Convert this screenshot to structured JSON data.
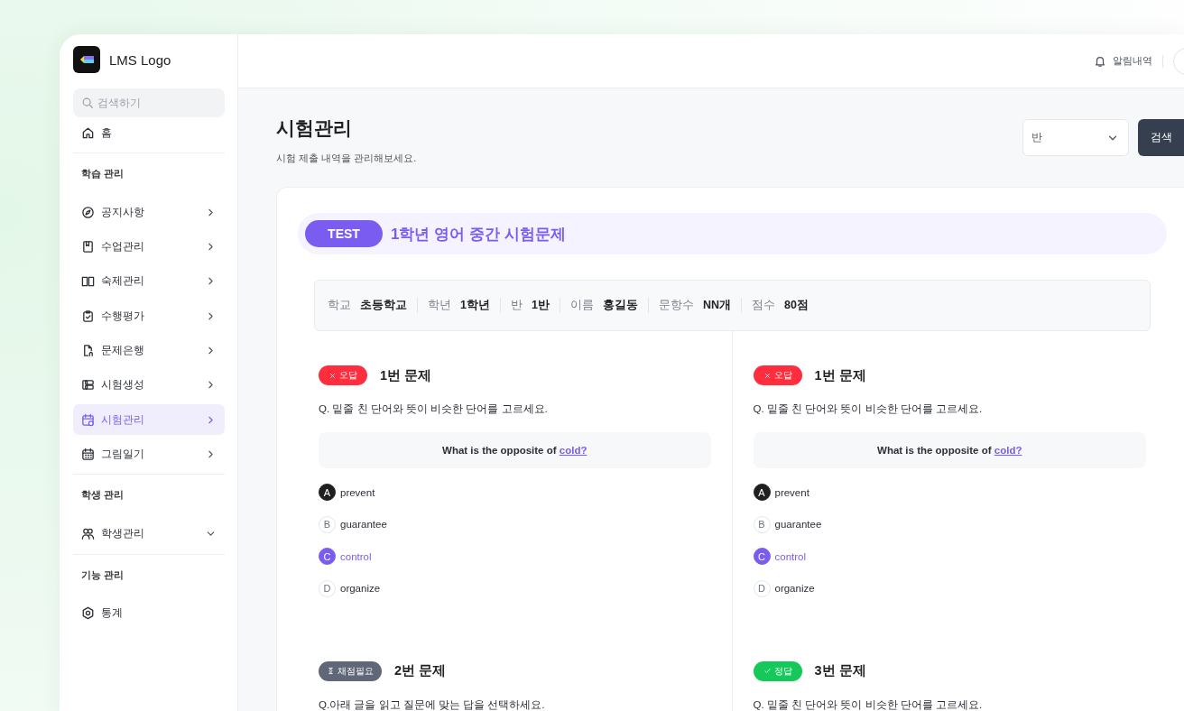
{
  "sidebar": {
    "logo": "LMS Logo",
    "search": {
      "placeholder": "검색하기"
    },
    "groups": [
      {
        "items": [
          {
            "label": "홈",
            "kind": "link",
            "selected": false
          }
        ]
      },
      {
        "title": "학습 관리",
        "items": [
          {
            "label": "공지사항",
            "kind": "submenu",
            "selected": false
          },
          {
            "label": "수업관리",
            "kind": "submenu",
            "selected": false
          },
          {
            "label": "숙제관리",
            "kind": "submenu",
            "selected": false
          },
          {
            "label": "수행평가",
            "kind": "submenu",
            "selected": false
          },
          {
            "label": "문제은행",
            "kind": "submenu",
            "selected": false
          },
          {
            "label": "시험생성",
            "kind": "submenu",
            "selected": false
          },
          {
            "label": "시험관리",
            "kind": "submenu",
            "selected": true
          },
          {
            "label": "그림일기",
            "kind": "submenu",
            "selected": false
          }
        ]
      },
      {
        "title": "학생 관리",
        "items": [
          {
            "label": "학생관리",
            "kind": "dropdown",
            "selected": false
          }
        ]
      },
      {
        "title": "기능 관리",
        "items": [
          {
            "label": "통계",
            "kind": "link",
            "selected": false
          }
        ]
      }
    ]
  },
  "header": {
    "notifications": "알림내역"
  },
  "page": {
    "title": "시험관리",
    "subtitle": "시험 제출 내역을 관리해보세요.",
    "filter": {
      "value": "반"
    },
    "search_button": "검색"
  },
  "exam": {
    "tag": "TEST",
    "title": "1학년 영어 중간 시험문제",
    "info": [
      {
        "label": "학교",
        "value": "초등학교"
      },
      {
        "label": "학년",
        "value": "1학년"
      },
      {
        "label": "반",
        "value": "1반"
      },
      {
        "label": "이름",
        "value": "홍길동"
      },
      {
        "label": "문항수",
        "value": "NN개"
      },
      {
        "label": "점수",
        "value": "80점"
      }
    ],
    "questions": [
      {
        "kind": "wrong",
        "badge": "오답",
        "title": "1번 문제",
        "instruction": "Q. 밑줄 친 단어와 뜻이 비슷한 단어를 고르세요.",
        "prompt": "What is the opposite of",
        "keyword": "cold?",
        "options": [
          {
            "letter": "A",
            "text": "prevent",
            "chosen": true,
            "correct": false
          },
          {
            "letter": "B",
            "text": "guarantee",
            "chosen": false,
            "correct": false
          },
          {
            "letter": "C",
            "text": "control",
            "chosen": false,
            "correct": true
          },
          {
            "letter": "D",
            "text": "organize",
            "chosen": false,
            "correct": false
          }
        ]
      },
      {
        "kind": "wrong",
        "badge": "오답",
        "title": "1번 문제",
        "instruction": "Q. 밑줄 친 단어와 뜻이 비슷한 단어를 고르세요.",
        "prompt": "What is the opposite of",
        "keyword": "cold?",
        "options": [
          {
            "letter": "A",
            "text": "prevent",
            "chosen": true,
            "correct": false
          },
          {
            "letter": "B",
            "text": "guarantee",
            "chosen": false,
            "correct": false
          },
          {
            "letter": "C",
            "text": "control",
            "chosen": false,
            "correct": true
          },
          {
            "letter": "D",
            "text": "organize",
            "chosen": false,
            "correct": false
          }
        ]
      },
      {
        "kind": "pending",
        "badge": "채점필요",
        "title": "2번 문제",
        "instruction": "Q.아래 글을 읽고 질문에 맞는 답을 선택하세요."
      },
      {
        "kind": "correct",
        "badge": "정답",
        "title": "3번 문제",
        "instruction": "Q. 밑줄 친 단어와 뜻이 비슷한 단어를 고르세요."
      }
    ]
  }
}
